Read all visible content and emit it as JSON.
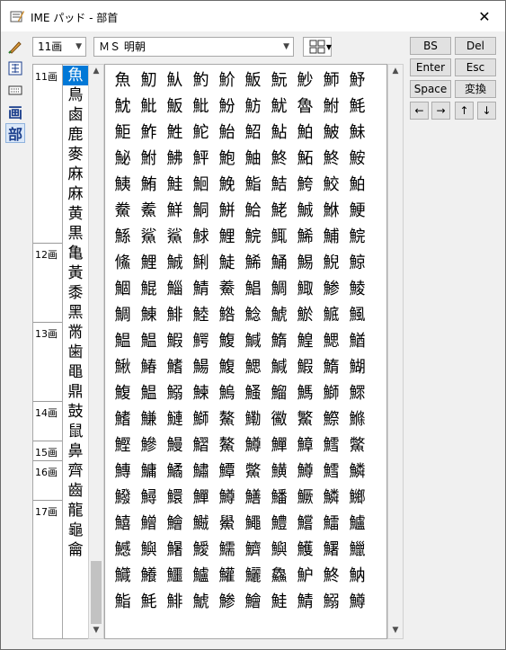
{
  "window": {
    "title": "IME パッド - 部首",
    "close_label": "✕"
  },
  "toolbar": {
    "stroke_select": "11画",
    "font_select": "ＭＳ 明朝",
    "mode_icons": [
      "handwriting-icon",
      "char-list-icon",
      "soft-keyboard-icon",
      "stroke-count-icon",
      "radical-icon"
    ],
    "stroke_tool_label": "画",
    "radical_tool_label": "部"
  },
  "stroke_groups": [
    "11画",
    "12画",
    "13画",
    "14画",
    "15画",
    "16画",
    "17画"
  ],
  "radicals": [
    "魚",
    "鳥",
    "鹵",
    "鹿",
    "麥",
    "麻",
    "麻",
    "黄",
    "黒",
    "亀",
    "黃",
    "黍",
    "黑",
    "黹",
    "歯",
    "黽",
    "鼎",
    "鼓",
    "鼠",
    "鼻",
    "齊",
    "齒",
    "龍",
    "龜",
    "龠"
  ],
  "selected_radical": "魚",
  "characters": [
    [
      "魚",
      "魛",
      "魜",
      "魡",
      "魪",
      "魬",
      "魭",
      "魦",
      "魳",
      "魣"
    ],
    [
      "魫",
      "魮",
      "魬",
      "魮",
      "魵",
      "魴",
      "魷",
      "魯",
      "鮒",
      "魹"
    ],
    [
      "鮔",
      "鮓",
      "鮏",
      "鮀",
      "鮐",
      "鮉",
      "鮎",
      "鮊",
      "鮍",
      "鮇"
    ],
    [
      "鮅",
      "鮒",
      "鮄",
      "鮃",
      "鮑",
      "鮋",
      "鮗",
      "鮖",
      "鮗",
      "鮟"
    ],
    [
      "鮧",
      "鮪",
      "鮭",
      "鮰",
      "鮸",
      "鮨",
      "鮚",
      "鮬",
      "鮫",
      "鮊"
    ],
    [
      "鮝",
      "鮺",
      "鮮",
      "鮦",
      "鮩",
      "鮯",
      "鮱",
      "鯎",
      "鮴",
      "鯁"
    ],
    [
      "鯀",
      "鯊",
      "鯊",
      "鯄",
      "鯉",
      "鯇",
      "鮿",
      "鯑",
      "鯆",
      "鯇"
    ],
    [
      "鯈",
      "鯉",
      "鯎",
      "鯏",
      "鯐",
      "鯑",
      "鯒",
      "鯣",
      "鯢",
      "鯨"
    ],
    [
      "鯝",
      "鯤",
      "鯔",
      "鯖",
      "鯗",
      "鯧",
      "鯛",
      "鯫",
      "鯵",
      "鯪"
    ],
    [
      "鯛",
      "鯟",
      "鯡",
      "鯥",
      "鯦",
      "鯰",
      "鯱",
      "鯲",
      "鯳",
      "鯴"
    ],
    [
      "鰛",
      "鰛",
      "鰕",
      "鰐",
      "鰒",
      "鰔",
      "鰖",
      "鰉",
      "鰓",
      "鰌"
    ],
    [
      "鰍",
      "鰆",
      "鰭",
      "鰑",
      "鰒",
      "鰓",
      "鰔",
      "鰕",
      "鰖",
      "鰗"
    ],
    [
      "鰒",
      "鰛",
      "鰯",
      "鰊",
      "鰞",
      "鰠",
      "鰡",
      "鰢",
      "鰤",
      "鰥"
    ],
    [
      "鰭",
      "鰜",
      "鰱",
      "鰤",
      "鰲",
      "鰳",
      "鰴",
      "鰵",
      "鰶",
      "鰷"
    ],
    [
      "鰹",
      "鰺",
      "鰻",
      "鰼",
      "鰲",
      "鱒",
      "鱓",
      "鱆",
      "鱈",
      "鱉"
    ],
    [
      "鱄",
      "鱅",
      "鱊",
      "鱐",
      "鱏",
      "鱉",
      "鱑",
      "鱒",
      "鱈",
      "鱗"
    ],
    [
      "鱍",
      "鱘",
      "鱞",
      "鱓",
      "鱒",
      "鱔",
      "鱕",
      "鱖",
      "鱗",
      "鱜"
    ],
    [
      "鱚",
      "鱛",
      "鱠",
      "鱡",
      "鱟",
      "鱦",
      "鱧",
      "鱨",
      "鱩",
      "鱸"
    ],
    [
      "鱤",
      "鱮",
      "鱪",
      "鱫",
      "鱬",
      "鱭",
      "鱮",
      "鱯",
      "鱰",
      "鱲"
    ],
    [
      "鱵",
      "鱶",
      "鱷",
      "鱸",
      "鱹",
      "鱺",
      "鱻",
      "魲",
      "鮗",
      "魶"
    ],
    [
      "鮨",
      "魹",
      "鯡",
      "鯱",
      "鯵",
      "鱠",
      "鮭",
      "鯖",
      "鰯",
      "鱒"
    ]
  ],
  "keys": {
    "bs": "BS",
    "del": "Del",
    "enter": "Enter",
    "esc": "Esc",
    "space": "Space",
    "convert": "変換",
    "left": "←",
    "right": "→",
    "up": "↑",
    "down": "↓"
  }
}
